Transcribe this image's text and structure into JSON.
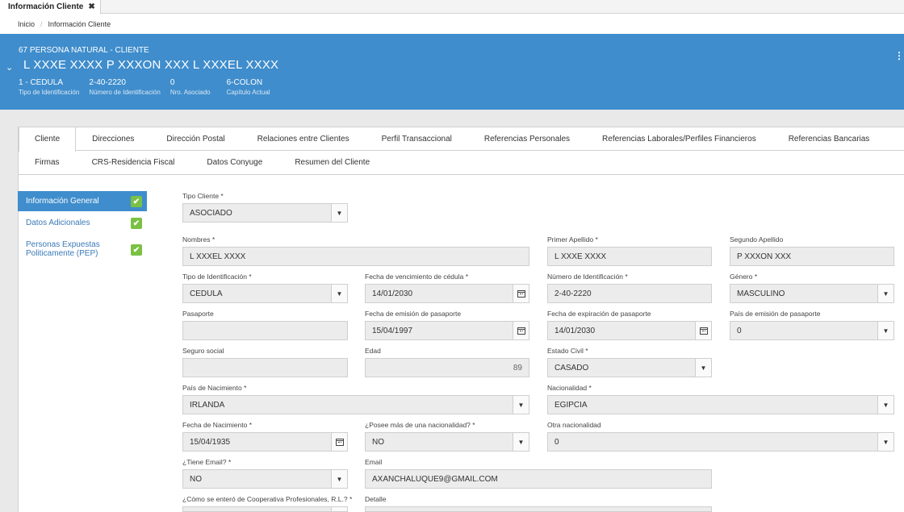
{
  "window": {
    "tab_title": "Información Cliente",
    "close_glyph": "✖"
  },
  "breadcrumb": {
    "home": "Inicio",
    "separator": "/",
    "current": "Información Cliente"
  },
  "header": {
    "line1": "67   PERSONA NATURAL - CLIENTE",
    "chevron": "⌄",
    "client_name": "L XXXE XXXX P XXXON XXX L XXXEL XXXX",
    "kebab": "⋮",
    "ids": [
      {
        "value": "1 - CEDULA",
        "label": "Tipo de Identificación"
      },
      {
        "value": "2-40-2220",
        "label": "Número de Identificación"
      },
      {
        "value": "0",
        "label": "Nro. Asociado"
      },
      {
        "value": "6-COLON",
        "label": "Capítulo Actual"
      }
    ]
  },
  "tabs": {
    "row1": [
      "Cliente",
      "Direcciones",
      "Dirección Postal",
      "Relaciones entre Clientes",
      "Perfil Transaccional",
      "Referencias Personales",
      "Referencias Laborales/Perfiles Financieros",
      "Referencias Bancarias"
    ],
    "row2": [
      "Firmas",
      "CRS-Residencia Fiscal",
      "Datos Conyuge",
      "Resumen del Cliente"
    ]
  },
  "side_menu": [
    {
      "label": "Información General",
      "checked": true
    },
    {
      "label": "Datos Adicionales",
      "checked": true
    },
    {
      "label": "Personas Expuestas Politicamente (PEP)",
      "checked": true
    }
  ],
  "check_glyph": "✔",
  "caret_glyph": "▼",
  "form": {
    "tipo_cliente": {
      "label": "Tipo Cliente",
      "value": "ASOCIADO"
    },
    "nombres": {
      "label": "Nombres",
      "value": "L XXXEL XXXX"
    },
    "primer_apellido": {
      "label": "Primer Apellido",
      "value": "L XXXE XXXX"
    },
    "segundo_apellido": {
      "label": "Segundo Apellido",
      "value": "P XXXON XXX"
    },
    "tipo_identificacion": {
      "label": "Tipo de Identificación",
      "value": "CEDULA"
    },
    "fecha_venc_cedula": {
      "label": "Fecha de vencimiento de cédula",
      "value": "14/01/2030"
    },
    "numero_identificacion": {
      "label": "Número de Identificación",
      "value": "2-40-2220"
    },
    "genero": {
      "label": "Género",
      "value": "MASCULINO"
    },
    "pasaporte": {
      "label": "Pasaporte",
      "value": ""
    },
    "fecha_emision_pasaporte": {
      "label": "Fecha de emisión de pasaporte",
      "value": "15/04/1997"
    },
    "fecha_exp_pasaporte": {
      "label": "Fecha de expiración de pasaporte",
      "value": "14/01/2030"
    },
    "pais_emision_pasaporte": {
      "label": "País de emisión de pasaporte",
      "value": "0"
    },
    "seguro_social": {
      "label": "Seguro social",
      "value": ""
    },
    "edad": {
      "label": "Edad",
      "value": "89"
    },
    "estado_civil": {
      "label": "Estado Civil",
      "value": "CASADO"
    },
    "pais_nacimiento": {
      "label": "País de Nacimiento",
      "value": "IRLANDA"
    },
    "nacionalidad": {
      "label": "Nacionalidad",
      "value": "EGIPCIA"
    },
    "fecha_nacimiento": {
      "label": "Fecha de Nacimiento",
      "value": "15/04/1935"
    },
    "mas_nacionalidad": {
      "label": "¿Posee más de una nacionalidad?",
      "value": "NO"
    },
    "otra_nacionalidad": {
      "label": "Otra nacionalidad",
      "value": "0"
    },
    "tiene_email": {
      "label": "¿Tiene Email?",
      "value": "NO"
    },
    "email": {
      "label": "Email",
      "value": "AXANCHALUQUE9@GMAIL.COM"
    },
    "como_se_entero": {
      "label": "¿Cómo se enteró de Cooperativa Profesionales, R.L.?",
      "value": ""
    },
    "detalle": {
      "label": "Detalle",
      "value": ""
    }
  },
  "required_mark": "*"
}
